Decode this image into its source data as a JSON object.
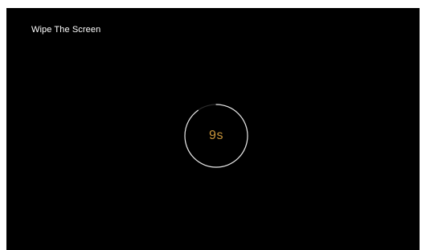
{
  "app": {
    "title": "Wipe The Screen"
  },
  "countdown": {
    "remaining_label": "9s",
    "progress_fraction": 0.9,
    "text_color": "#c8943a",
    "ring_color": "#e6e6e6",
    "track_color": "#2a2a2a"
  },
  "colors": {
    "background": "#000000",
    "title_text": "#ffffff"
  }
}
